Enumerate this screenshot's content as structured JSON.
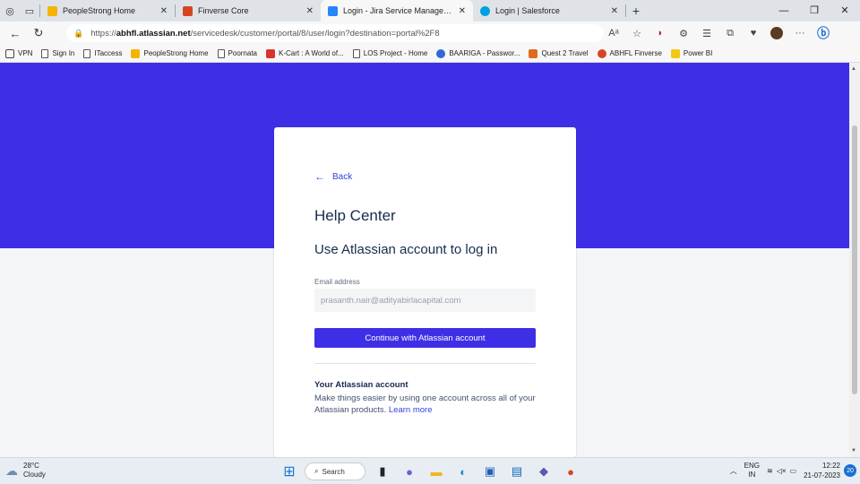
{
  "browser": {
    "tabs": [
      {
        "title": "PeopleStrong Home",
        "color": "#f4b400"
      },
      {
        "title": "Finverse Core",
        "color": "#d64522"
      },
      {
        "title": "Login - Jira Service Management",
        "color": "#2684ff",
        "active": true
      },
      {
        "title": "Login | Salesforce",
        "color": "#00a1e0"
      }
    ],
    "url_prefix": "https://",
    "url_domain": "abhfl.atlassian.net",
    "url_path": "/servicedesk/customer/portal/8/user/login?destination=portal%2F8",
    "bookmarks": [
      {
        "label": "VPN",
        "icon": "page-icon"
      },
      {
        "label": "Sign In",
        "icon": "page-icon"
      },
      {
        "label": "ITaccess",
        "icon": "page-icon"
      },
      {
        "label": "PeopleStrong Home",
        "icon": "peoplestrong-icon",
        "color": "#f4b400"
      },
      {
        "label": "Poornata",
        "icon": "page-icon"
      },
      {
        "label": "K-Cart : A World of...",
        "icon": "kcart-icon",
        "color": "#d9342b"
      },
      {
        "label": "LOS Project - Home",
        "icon": "page-icon"
      },
      {
        "label": "BAARIGA - Passwor...",
        "icon": "baariga-icon",
        "color": "#3367d6"
      },
      {
        "label": "Quest 2 Travel",
        "icon": "travel-icon",
        "color": "#e06b1f"
      },
      {
        "label": "ABHFL Finverse",
        "icon": "finverse-icon",
        "color": "#d64522"
      },
      {
        "label": "Power BI",
        "icon": "powerbi-icon",
        "color": "#f2c811"
      }
    ]
  },
  "card": {
    "back_label": "Back",
    "title": "Help Center",
    "subtitle": "Use Atlassian account to log in",
    "email_label": "Email address",
    "email_value": "prasanth.nair@adityabirlacapital.com",
    "continue_label": "Continue with Atlassian account",
    "account_title": "Your Atlassian account",
    "account_desc": "Make things easier by using one account across all of your Atlassian products.",
    "learn_more": "Learn more"
  },
  "colors": {
    "brand": "#3e2fe6",
    "link": "#3344dd"
  },
  "taskbar": {
    "temperature": "28°C",
    "weather": "Cloudy",
    "search_label": "Search",
    "lang_top": "ENG",
    "lang_bottom": "IN",
    "time": "12:22",
    "date": "21-07-2023",
    "notifications": "20"
  }
}
